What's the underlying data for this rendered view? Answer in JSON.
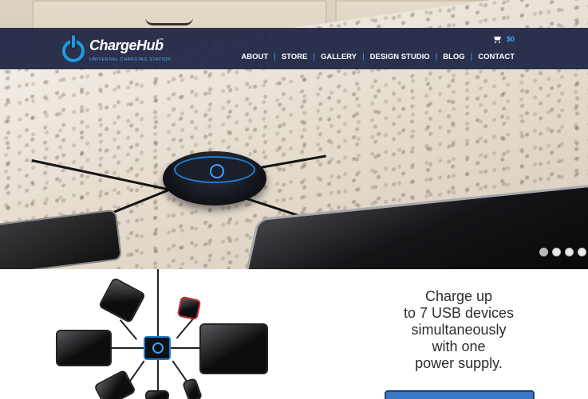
{
  "brand": {
    "name": "ChargeHub",
    "trademark": "™",
    "tagline": "UNIVERSAL CHARGING STATION",
    "accent_color": "#1f9be0",
    "nav_background": "#212744"
  },
  "cart": {
    "icon": "cart-icon",
    "amount": "$0"
  },
  "nav": {
    "items": [
      "ABOUT",
      "STORE",
      "GALLERY",
      "DESIGN STUDIO",
      "BLOG",
      "CONTACT"
    ],
    "separator": "|"
  },
  "slider": {
    "slide_count": 4,
    "active_index": 0
  },
  "promo": {
    "lines": [
      "Charge up",
      "to 7 USB devices",
      "simultaneously",
      "with one",
      "power supply."
    ],
    "cta_color": "#3b78c6"
  }
}
